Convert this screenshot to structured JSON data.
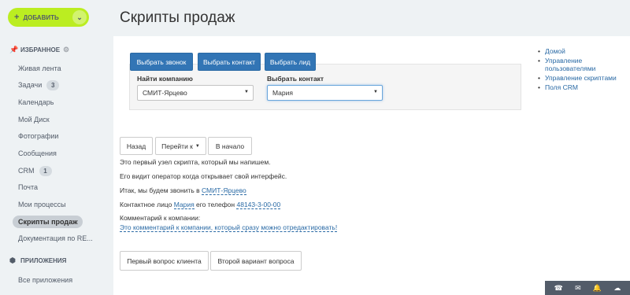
{
  "sidebar": {
    "add_label": "ДОБАВИТЬ",
    "favorites_title": "ИЗБРАННОЕ",
    "items": [
      {
        "label": "Живая лента",
        "counter": ""
      },
      {
        "label": "Задачи",
        "counter": "3"
      },
      {
        "label": "Календарь",
        "counter": ""
      },
      {
        "label": "Мой Диск",
        "counter": ""
      },
      {
        "label": "Фотографии",
        "counter": ""
      },
      {
        "label": "Сообщения",
        "counter": ""
      },
      {
        "label": "CRM",
        "counter": "1"
      },
      {
        "label": "Почта",
        "counter": ""
      },
      {
        "label": "Мои процессы",
        "counter": ""
      },
      {
        "label": "Скрипты продаж",
        "counter": ""
      },
      {
        "label": "Документация по RE...",
        "counter": ""
      }
    ],
    "apps_title": "ПРИЛОЖЕНИЯ",
    "all_apps": "Все приложения"
  },
  "header": {
    "title": "Скрипты продаж"
  },
  "toolbar": {
    "select_call": "Выбрать звонок",
    "select_contact": "Выбрать контакт",
    "select_lead": "Выбрать лид"
  },
  "filters": {
    "company_label": "Найти компанию",
    "company_value": "СМИТ-Ярцево",
    "contact_label": "Выбрать контакт",
    "contact_value": "Мария"
  },
  "links": [
    "Домой",
    "Управление пользователями",
    "Управление скриптами",
    "Поля CRM"
  ],
  "nav": {
    "back": "Назад",
    "goto": "Перейти к",
    "start": "В начало"
  },
  "script": {
    "line1": "Это первый узел скрипта, который мы напишем.",
    "line2": "Его видит оператор когда открывает свой интерфейс.",
    "line3_prefix": "Итак, мы будем звонить в ",
    "line3_company": "СМИТ-Ярцево",
    "line4_prefix": "Контактное лицо ",
    "line4_contact": "Мария",
    "line4_middle": " его телефон ",
    "line4_phone": "48143-3-00-00",
    "comment_label": "Комментарий к компании:",
    "comment_text": "Это комментарий к компании, который сразу можно отредактировать!"
  },
  "answers": {
    "first": "Первый вопрос клиента",
    "second": "Второй вариант вопроса"
  },
  "colors": {
    "accent_green": "#bbed21",
    "primary_blue": "#3275b5",
    "link": "#2a6aa5"
  }
}
